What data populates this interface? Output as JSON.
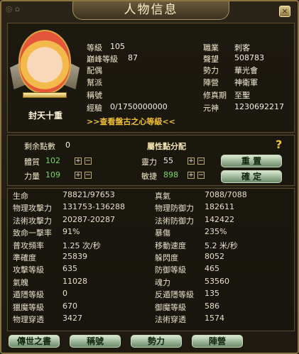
{
  "window": {
    "title": "人物信息",
    "close_glyph": "×"
  },
  "profile": {
    "rank_name": "封天十重",
    "left_fields": [
      {
        "label": "等級",
        "value": "105"
      },
      {
        "label": "巔峰等級",
        "value": "87"
      },
      {
        "label": "配偶",
        "value": ""
      },
      {
        "label": "幫派",
        "value": ""
      },
      {
        "label": "稱號",
        "value": ""
      },
      {
        "label": "經驗",
        "value": "0/1750000000"
      }
    ],
    "right_fields": [
      {
        "label": "職業",
        "value": "刺客"
      },
      {
        "label": "聲望",
        "value": "508783"
      },
      {
        "label": "勢力",
        "value": "華光會"
      },
      {
        "label": "陣營",
        "value": "神衛軍"
      },
      {
        "label": "修真期",
        "value": "至聖"
      },
      {
        "label": "元神",
        "value": "1230692217"
      }
    ],
    "link": ">>查看盤古之心等級<<"
  },
  "attributes": {
    "free_points_label": "剩余點數",
    "free_points_value": "0",
    "section_title": "屬性點分配",
    "help_glyph": "?",
    "items": [
      {
        "label": "體質",
        "value": "102"
      },
      {
        "label": "力量",
        "value": "109"
      },
      {
        "label": "靈力",
        "value": "55"
      },
      {
        "label": "敏捷",
        "value": "898"
      }
    ],
    "plus_glyph": "+",
    "minus_glyph": "−",
    "reset_label": "重 置",
    "confirm_label": "確 定"
  },
  "stats": [
    {
      "l1": "生命",
      "v1": "78821/97653",
      "l2": "真氣",
      "v2": "7088/7088"
    },
    {
      "l1": "物理攻擊力",
      "v1": "131753-136288",
      "l2": "物理防御力",
      "v2": "182611"
    },
    {
      "l1": "法術攻擊力",
      "v1": "20287-20287",
      "l2": "法術防御力",
      "v2": "142422"
    },
    {
      "l1": "致命一擊率",
      "v1": "91%",
      "l2": "暴傷",
      "v2": "235%"
    },
    {
      "l1": "普攻頻率",
      "v1": "1.25 次/秒",
      "l2": "移動速度",
      "v2": "5.2 米/秒"
    },
    {
      "l1": "準確度",
      "v1": "25839",
      "l2": "躲閃度",
      "v2": "8052"
    },
    {
      "l1": "攻擊等級",
      "v1": "635",
      "l2": "防御等級",
      "v2": "465"
    },
    {
      "l1": "氣魄",
      "v1": "11028",
      "l2": "魂力",
      "v2": "53560"
    },
    {
      "l1": "遁隱等級",
      "v1": "0",
      "l2": "反遁隱等級",
      "v2": "135"
    },
    {
      "l1": "獵魔等級",
      "v1": "670",
      "l2": "御魔等級",
      "v2": "586"
    },
    {
      "l1": "物理穿透",
      "v1": "3427",
      "l2": "法術穿透",
      "v2": "1574"
    }
  ],
  "tabs": [
    "傳世之書",
    "稱號",
    "勢力",
    "陣營"
  ]
}
